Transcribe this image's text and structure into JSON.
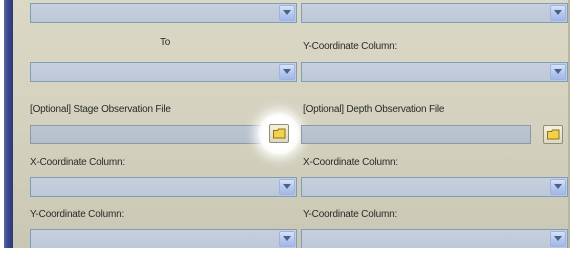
{
  "labels": {
    "to": "To",
    "y_coordinate_column_top": "Y-Coordinate Column:",
    "stage_observation_file": "[Optional] Stage Observation File",
    "depth_observation_file": "[Optional] Depth Observation File",
    "x_coordinate_column_left": "X-Coordinate Column:",
    "x_coordinate_column_right": "X-Coordinate Column:",
    "y_coordinate_column_left": "Y-Coordinate Column:",
    "y_coordinate_column_right": "Y-Coordinate Column:"
  },
  "fields": {
    "combo_top_left": "",
    "combo_top_right": "",
    "combo_to": "",
    "combo_y_top_right": "",
    "stage_file_path": "",
    "depth_file_path": "",
    "combo_x_left": "",
    "combo_x_right": "",
    "combo_y_left": "",
    "combo_y_right": ""
  },
  "icons": {
    "browse": "folder-icon",
    "dropdown": "chevron-down-icon"
  },
  "colors": {
    "panel_bg": "#d6d4c1",
    "left_bar": "#3b4a8f",
    "combo_bg": "#c2cddc",
    "combo_border": "#7f9db9",
    "folder_fill": "#f2d24a"
  }
}
